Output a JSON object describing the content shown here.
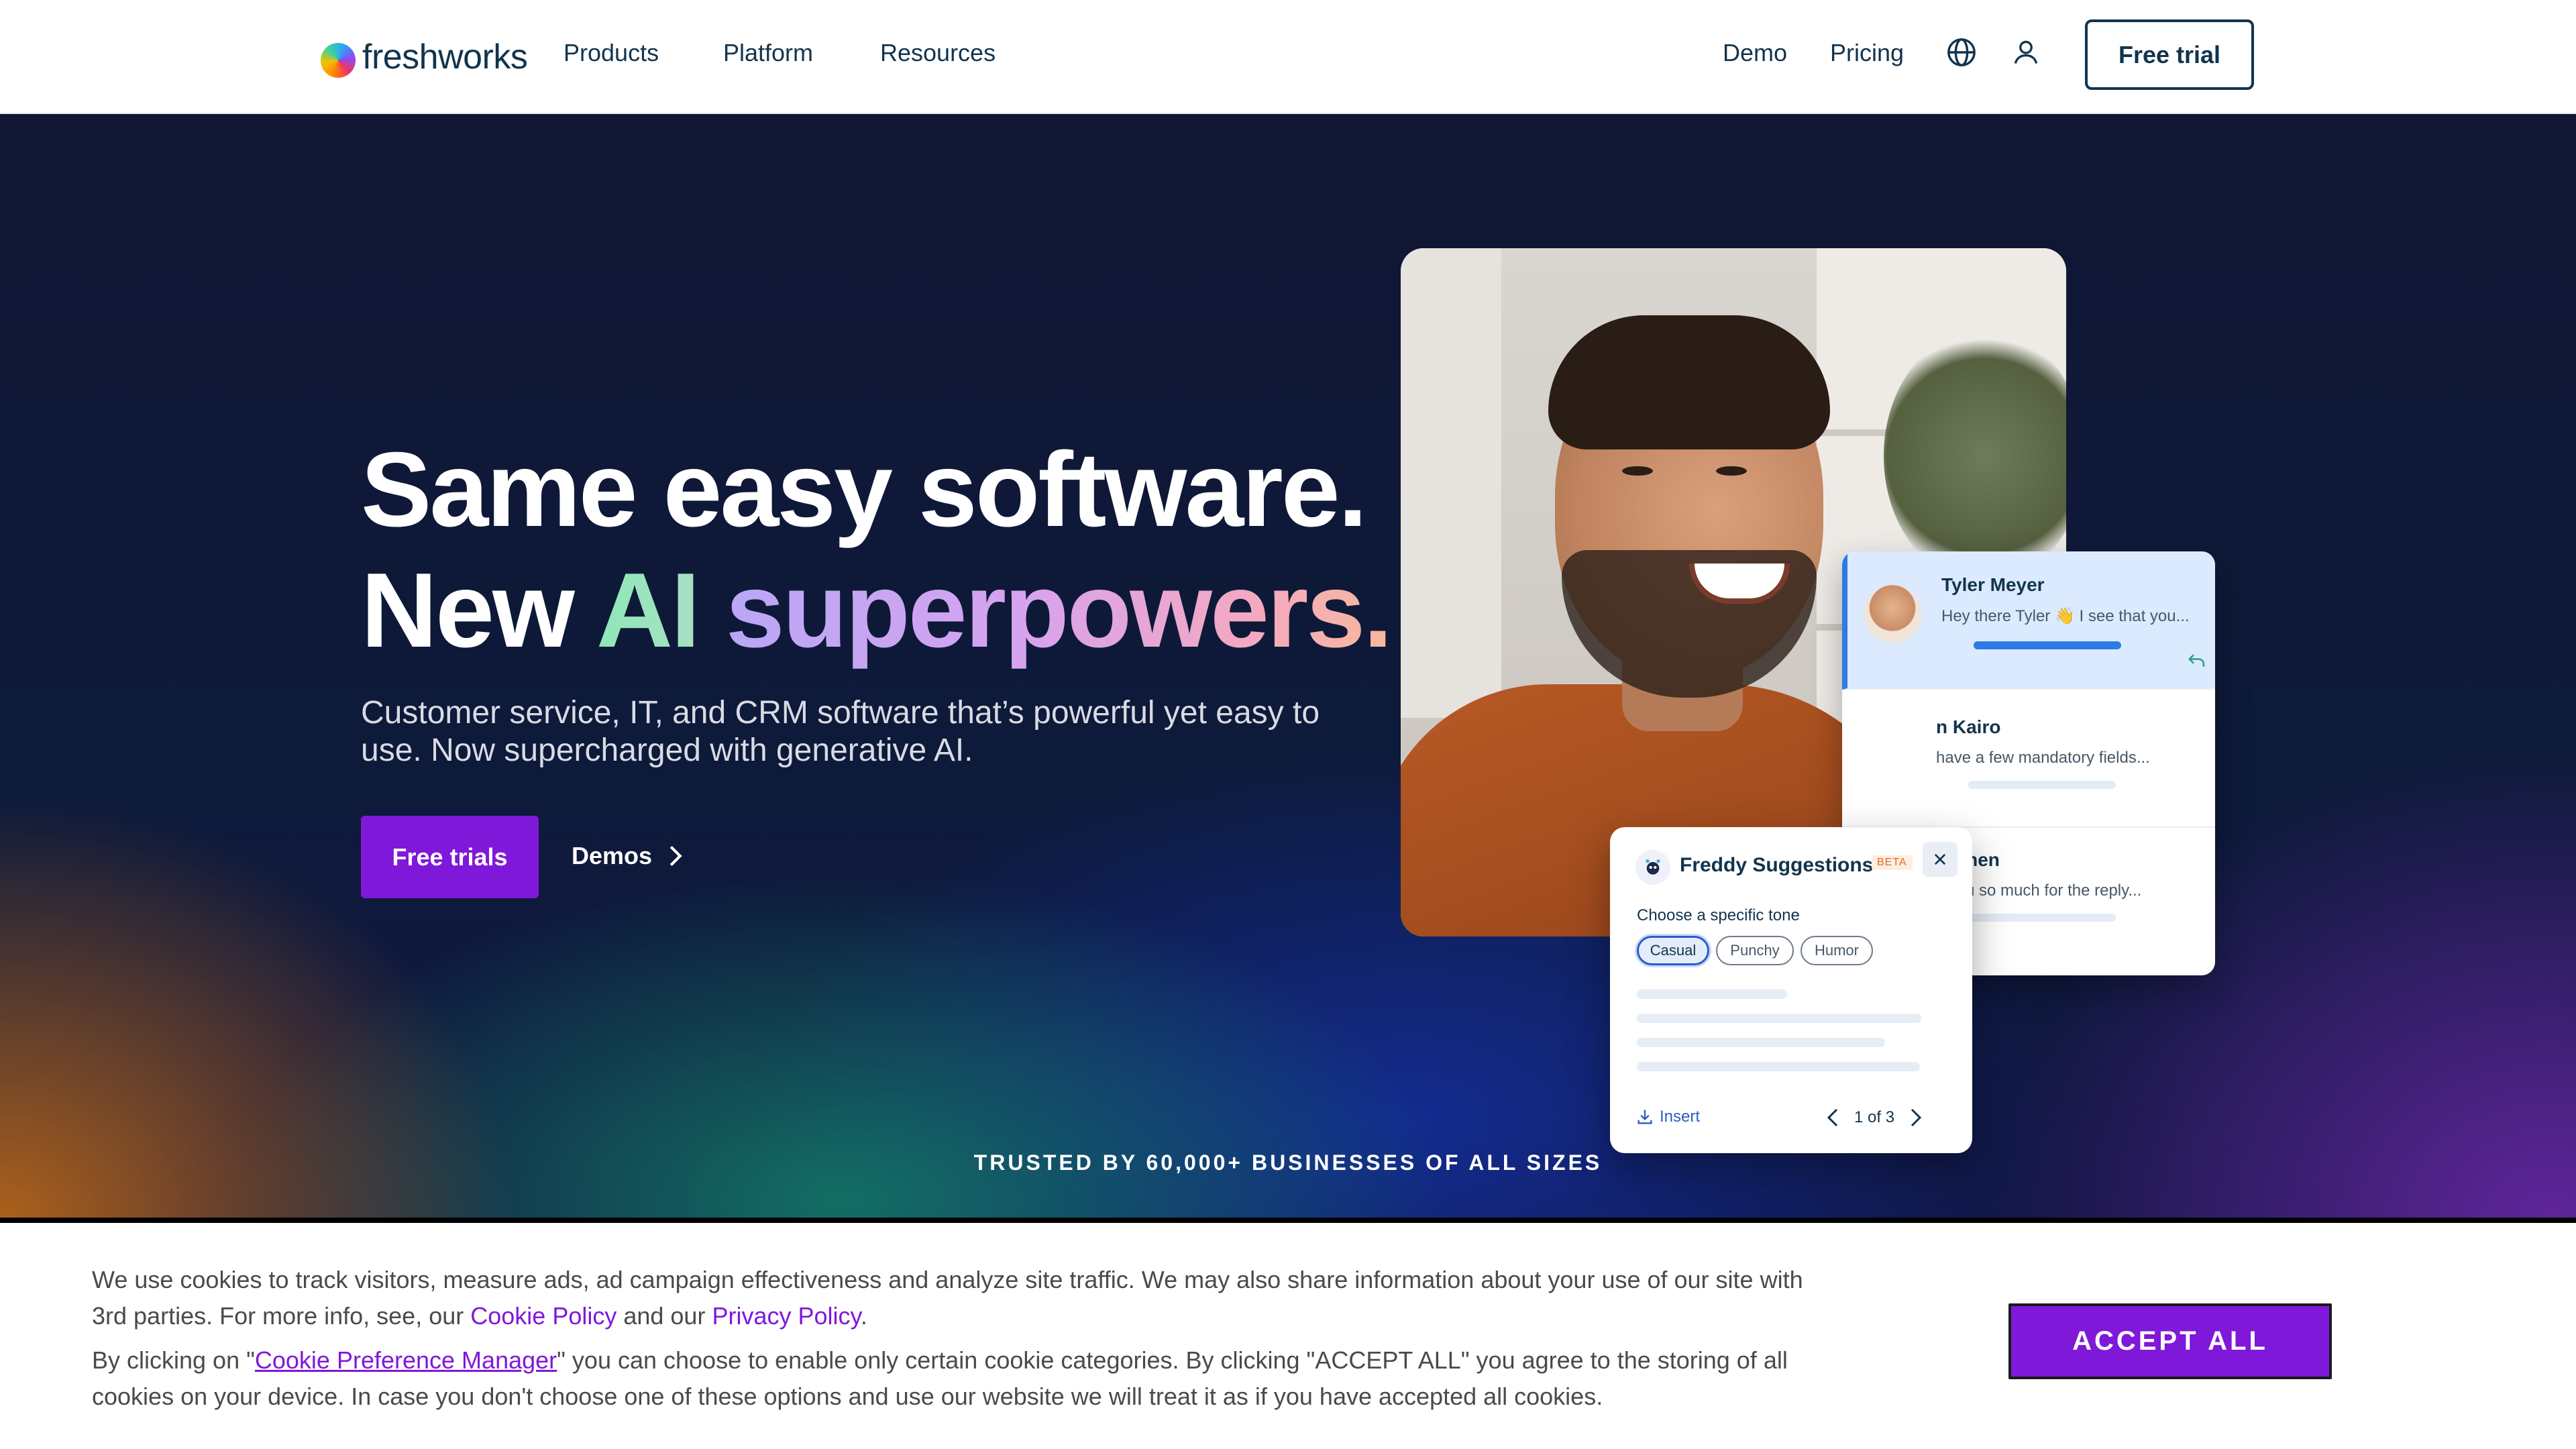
{
  "header": {
    "logo_text": "freshworks",
    "nav": [
      "Products",
      "Platform",
      "Resources"
    ],
    "demo": "Demo",
    "pricing": "Pricing",
    "free_trial": "Free trial"
  },
  "hero": {
    "title_line1": "Same easy software.",
    "title_new": "New",
    "title_ai": "AI",
    "title_super": "superpowers.",
    "subtitle": "Customer service, IT, and CRM software that’s powerful yet easy to use. Now supercharged with generative AI.",
    "cta_primary": "Free trials",
    "cta_secondary": "Demos",
    "trusted": "TRUSTED BY 60,000+ BUSINESSES OF ALL SIZES"
  },
  "chat_list": [
    {
      "name": "Tyler Meyer",
      "message": "Hey there Tyler 👋 I see that you..."
    },
    {
      "name": "n Kairo",
      "message": "have a few mandatory fields..."
    },
    {
      "name": "n Chen",
      "message": "k you so much for the reply..."
    }
  ],
  "freddy": {
    "title": "Freddy Suggestions",
    "badge": "BETA",
    "tone_label": "Choose a specific tone",
    "tones": [
      "Casual",
      "Punchy",
      "Humor"
    ],
    "selected_tone": "Casual",
    "insert": "Insert",
    "pager": "1 of 3"
  },
  "cookie": {
    "p1_before": "We use cookies to track visitors, measure ads, ad campaign effectiveness and analyze site traffic. We may also share information about your use of our site with 3rd parties. For more info, see, our ",
    "cookie_policy": "Cookie Policy",
    "p1_mid": " and our ",
    "privacy_policy": "Privacy Policy",
    "p1_end": ".",
    "p2_before": "By clicking on \"",
    "preference_manager": "Cookie Preference Manager",
    "p2_after": "\" you can choose to enable only certain cookie categories. By clicking \"ACCEPT ALL\" you agree to the storing of all cookies on your device. In case you don't choose one of these options and use our website we will treat it as if you have accepted all cookies.",
    "accept_all": "ACCEPT ALL"
  },
  "colors": {
    "brand_purple": "#7f18d9",
    "navy": "#12344d"
  }
}
